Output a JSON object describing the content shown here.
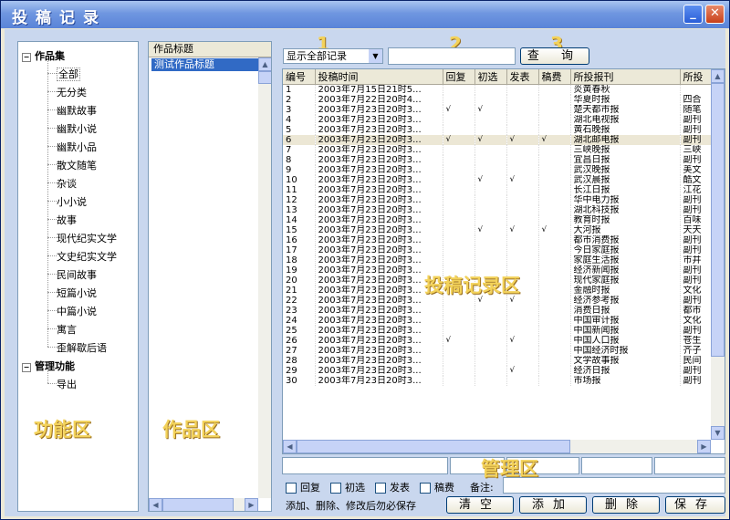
{
  "window": {
    "title": "投稿记录",
    "min_label": "_",
    "close_label": "✕"
  },
  "tree": {
    "collapse_symbol": "−",
    "groups": [
      {
        "label": "作品集",
        "items": [
          "全部",
          "无分类",
          "幽默故事",
          "幽默小说",
          "幽默小品",
          "散文随笔",
          "杂谈",
          "小小说",
          "故事",
          "现代纪实文学",
          "文史纪实文学",
          "民间故事",
          "短篇小说",
          "中篇小说",
          "寓言",
          "歪解歇后语"
        ]
      },
      {
        "label": "管理功能",
        "items": [
          "导出"
        ]
      }
    ]
  },
  "zones": {
    "function": "功能区",
    "works": "作品区",
    "records": "投稿记录区",
    "manage": "管理区"
  },
  "works": {
    "header": "作品标题",
    "items": [
      "测试作品标题"
    ]
  },
  "toolbar": {
    "filter_value": "显示全部记录",
    "search_value": "",
    "search_button": "查 询",
    "num1": "1",
    "num2": "2",
    "num3": "3"
  },
  "grid": {
    "columns": [
      "编号",
      "投稿时间",
      "回复",
      "初选",
      "发表",
      "稿费",
      "所投报刊",
      "所投"
    ],
    "rows": [
      [
        "1",
        "2003年7月15日21时5...",
        "",
        "",
        "",
        "",
        "炎黄春秋",
        ""
      ],
      [
        "2",
        "2003年7月22日20时4...",
        "",
        "",
        "",
        "",
        "华夏时报",
        "四合"
      ],
      [
        "3",
        "2003年7月23日20时3...",
        "√",
        "√",
        "",
        "",
        "楚天都市报",
        "随笔"
      ],
      [
        "4",
        "2003年7月23日20时3...",
        "",
        "",
        "",
        "",
        "湖北电视报",
        "副刊"
      ],
      [
        "5",
        "2003年7月23日20时3...",
        "",
        "",
        "",
        "",
        "黄石晚报",
        "副刊"
      ],
      [
        "6",
        "2003年7月23日20时3...",
        "√",
        "√",
        "√",
        "√",
        "湖北邮电报",
        "副刊"
      ],
      [
        "7",
        "2003年7月23日20时3...",
        "",
        "",
        "",
        "",
        "三峡晚报",
        "三峡"
      ],
      [
        "8",
        "2003年7月23日20时3...",
        "",
        "",
        "",
        "",
        "宜昌日报",
        "副刊"
      ],
      [
        "9",
        "2003年7月23日20时3...",
        "",
        "",
        "",
        "",
        "武汉晚报",
        "美文"
      ],
      [
        "10",
        "2003年7月23日20时3...",
        "",
        "√",
        "√",
        "",
        "武汉晨报",
        "酷文"
      ],
      [
        "11",
        "2003年7月23日20时3...",
        "",
        "",
        "",
        "",
        "长江日报",
        "江花"
      ],
      [
        "12",
        "2003年7月23日20时3...",
        "",
        "",
        "",
        "",
        "华中电力报",
        "副刊"
      ],
      [
        "13",
        "2003年7月23日20时3...",
        "",
        "",
        "",
        "",
        "湖北科技报",
        "副刊"
      ],
      [
        "14",
        "2003年7月23日20时3...",
        "",
        "",
        "",
        "",
        "教育时报",
        "百味"
      ],
      [
        "15",
        "2003年7月23日20时3...",
        "",
        "√",
        "√",
        "√",
        "大河报",
        "天天"
      ],
      [
        "16",
        "2003年7月23日20时3...",
        "",
        "",
        "",
        "",
        "都市消费报",
        "副刊"
      ],
      [
        "17",
        "2003年7月23日20时3...",
        "",
        "",
        "",
        "",
        "今日家庭报",
        "副刊"
      ],
      [
        "18",
        "2003年7月23日20时3...",
        "",
        "",
        "",
        "",
        "家庭生活报",
        "市井"
      ],
      [
        "19",
        "2003年7月23日20时3...",
        "",
        "",
        "",
        "",
        "经济新闻报",
        "副刊"
      ],
      [
        "20",
        "2003年7月23日20时3...",
        "",
        "",
        "",
        "",
        "现代家庭报",
        "副刊"
      ],
      [
        "21",
        "2003年7月23日20时3...",
        "",
        "",
        "",
        "",
        "金融时报",
        "文化"
      ],
      [
        "22",
        "2003年7月23日20时3...",
        "",
        "√",
        "√",
        "",
        "经济参考报",
        "副刊"
      ],
      [
        "23",
        "2003年7月23日20时3...",
        "",
        "",
        "",
        "",
        "消费日报",
        "都市"
      ],
      [
        "24",
        "2003年7月23日20时3...",
        "",
        "",
        "",
        "",
        "中国审计报",
        "文化"
      ],
      [
        "25",
        "2003年7月23日20时3...",
        "",
        "",
        "",
        "",
        "中国新闻报",
        "副刊"
      ],
      [
        "26",
        "2003年7月23日20时3...",
        "√",
        "",
        "√",
        "",
        "中国人口报",
        "苍生"
      ],
      [
        "27",
        "2003年7月23日20时3...",
        "",
        "",
        "",
        "",
        "中国经济时报",
        "齐子"
      ],
      [
        "28",
        "2003年7月23日20时3...",
        "",
        "",
        "",
        "",
        "文学故事报",
        "民间"
      ],
      [
        "29",
        "2003年7月23日20时3...",
        "",
        "",
        "√",
        "",
        "经济日报",
        "副刊"
      ],
      [
        "30",
        "2003年7月23日20时3...",
        "",
        "",
        "",
        "",
        "市场报",
        "副刊"
      ]
    ],
    "highlight_row": 6
  },
  "manage": {
    "checkboxes": [
      "回复",
      "初选",
      "发表",
      "稿费"
    ],
    "remark_label": "备注:",
    "note": "添加、删除、修改后勿必保存",
    "buttons": {
      "clear": "清空",
      "add": "添加",
      "delete": "删除",
      "save": "保存"
    }
  },
  "colors": {
    "accent": "#316ac5",
    "zone_label": "#f3d25a",
    "panel_bg": "#c9d7ee"
  }
}
